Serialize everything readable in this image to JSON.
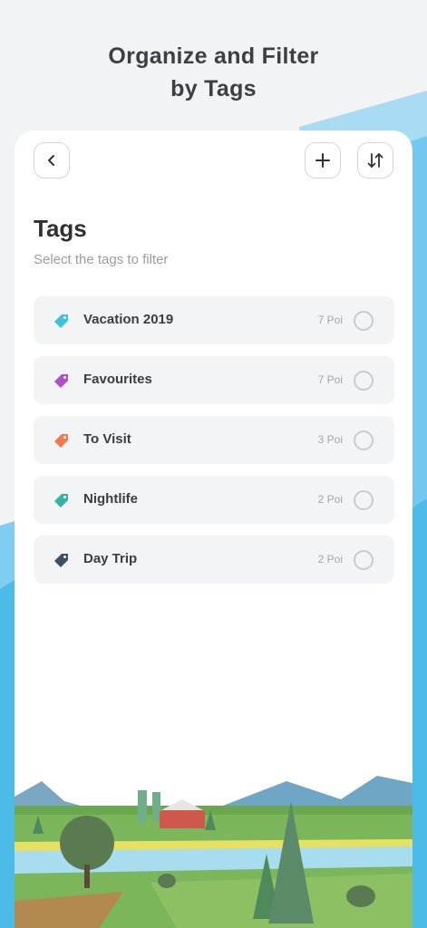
{
  "header": {
    "line1": "Organize and Filter",
    "line2": "by Tags"
  },
  "toolbar": {
    "back_icon": "chevron-left-icon",
    "add_icon": "plus-icon",
    "sort_icon": "sort-arrows-icon"
  },
  "page": {
    "title": "Tags",
    "subtitle": "Select the tags to filter"
  },
  "tags": [
    {
      "label": "Vacation 2019",
      "count": "7 Poi",
      "color": "#3fc3da",
      "icon": "tag-icon"
    },
    {
      "label": "Favourites",
      "count": "7 Poi",
      "color": "#b050c8",
      "icon": "tag-icon"
    },
    {
      "label": "To Visit",
      "count": "3 Poi",
      "color": "#f07a4c",
      "icon": "tag-icon"
    },
    {
      "label": "Nightlife",
      "count": "2 Poi",
      "color": "#35b3a3",
      "icon": "tag-icon"
    },
    {
      "label": "Day Trip",
      "count": "2 Poi",
      "color": "#3f4d66",
      "icon": "tag-icon"
    }
  ],
  "colors": {
    "background": "#f2f3f5",
    "sky": "#5bc0e8",
    "card": "#ffffff"
  }
}
